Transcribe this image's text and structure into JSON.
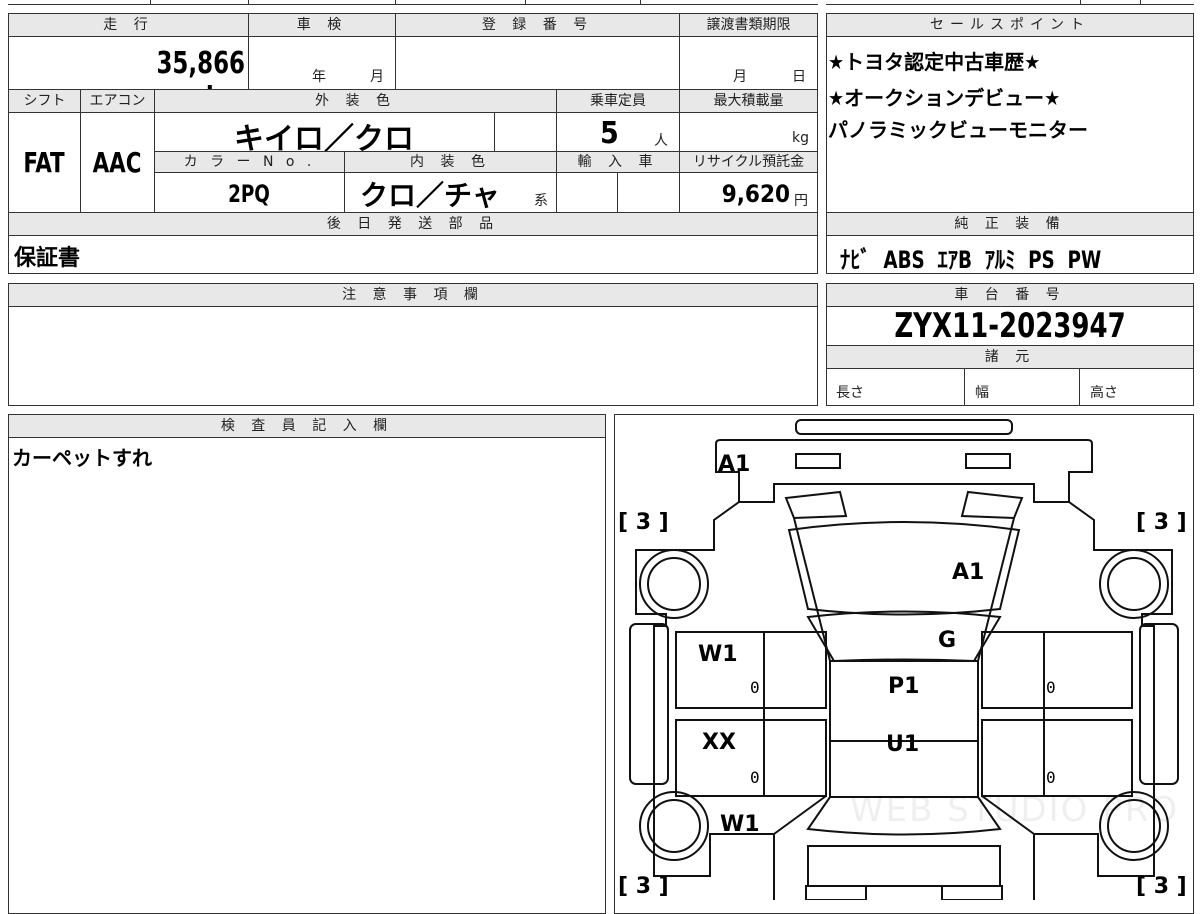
{
  "top_strip": {
    "fragment_a": "IIII",
    "fragment_b": "…"
  },
  "mileage": {
    "label": "走 行",
    "value": "35,866 km"
  },
  "shaken": {
    "label": "車 検",
    "year": "年",
    "month": "月"
  },
  "registration": {
    "label": "登 録 番 号",
    "value": ""
  },
  "transfer_docs": {
    "label": "譲渡書類期限",
    "month": "月",
    "day": "日"
  },
  "shift": {
    "label": "シフト",
    "value": "FAT"
  },
  "aircon": {
    "label": "エアコン",
    "value": "AAC"
  },
  "exterior_color": {
    "label": "外 装 色",
    "value": "キイロ／クロ"
  },
  "capacity": {
    "label": "乗車定員",
    "value": "5",
    "unit": "人"
  },
  "max_load": {
    "label": "最大積載量",
    "unit": "kg"
  },
  "color_no": {
    "label": "カ ラ ー N o .",
    "value": "2PQ"
  },
  "interior_color": {
    "label": "内 装 色",
    "value": "クロ／チャ",
    "suffix": "系"
  },
  "import": {
    "label": "輸 入 車"
  },
  "recycle": {
    "label": "リサイクル預託金",
    "value": "9,620",
    "unit": "円"
  },
  "later_parts": {
    "label": "後 日 発 送 部 品",
    "value": "保証書"
  },
  "notes": {
    "label": "注 意 事 項 欄"
  },
  "sales_points": {
    "label": "セールスポイント",
    "lines": [
      "★トヨタ認定中古車歴★",
      "★オークションデビュー★",
      "パノラミックビューモニター"
    ]
  },
  "equipment": {
    "label": "純 正 装 備",
    "value": "ﾅﾋﾞ  ABS  ｴｱB  ｱﾙﾐ  PS  PW"
  },
  "chassis": {
    "label": "車 台 番 号",
    "value": "ZYX11-2023947"
  },
  "specs": {
    "label": "諸 元",
    "length": "長さ",
    "width": "幅",
    "height": "高さ"
  },
  "inspector": {
    "label": "検 査 員 記 入 欄",
    "comment": "カーペットすれ"
  },
  "diagram": {
    "front_bumper": "A1",
    "hood": "A1",
    "windshield": "G",
    "roof": "P1",
    "roof_rear": "U1",
    "left_front_door": "W1",
    "left_rear_door": "XX",
    "left_rear_fender": "W1",
    "tire_fl": "[ 3 ]",
    "tire_fr": "[ 3 ]",
    "tire_rl": "[ 3 ]",
    "tire_rr": "[ 3 ]",
    "zero_lf": "0",
    "zero_lr": "0",
    "zero_rf": "0",
    "zero_rr": "0",
    "watermark": "WEB STUDIO PRO"
  }
}
